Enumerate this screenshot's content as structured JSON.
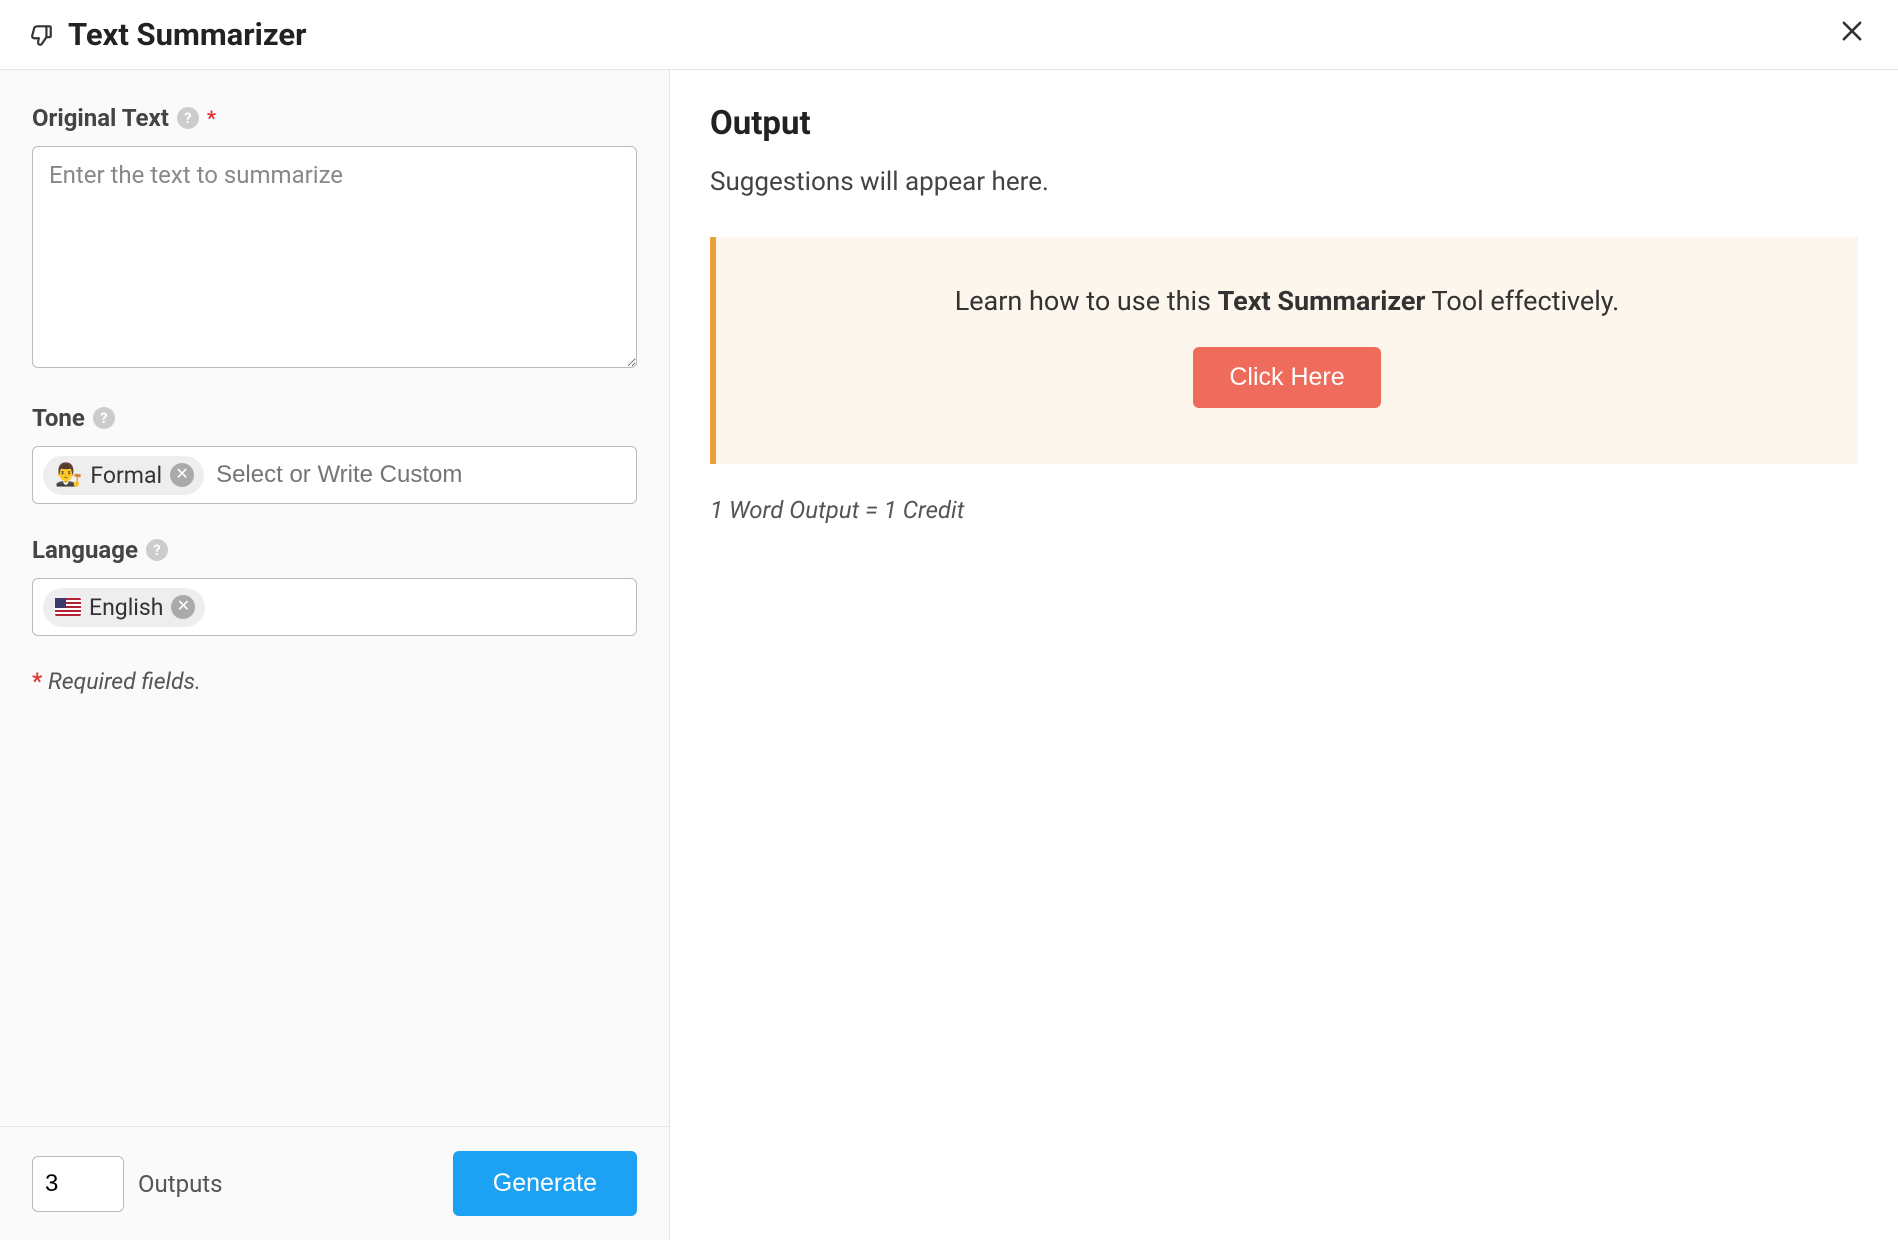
{
  "header": {
    "title": "Text Summarizer"
  },
  "form": {
    "originalText": {
      "label": "Original Text",
      "placeholder": "Enter the text to summarize",
      "value": ""
    },
    "tone": {
      "label": "Tone",
      "chipLabel": "Formal",
      "chipEmoji": "👨‍⚖️",
      "placeholder": "Select or Write Custom"
    },
    "language": {
      "label": "Language",
      "chipLabel": "English"
    },
    "requiredNote": "Required fields."
  },
  "bottomBar": {
    "outputsCount": "3",
    "outputsLabel": "Outputs",
    "generateLabel": "Generate"
  },
  "output": {
    "title": "Output",
    "suggestions": "Suggestions will appear here.",
    "banner": {
      "prefix": "Learn how to use this ",
      "strong": "Text Summarizer",
      "suffix": " Tool effectively.",
      "buttonLabel": "Click Here"
    },
    "creditNote": "1 Word Output = 1 Credit"
  }
}
